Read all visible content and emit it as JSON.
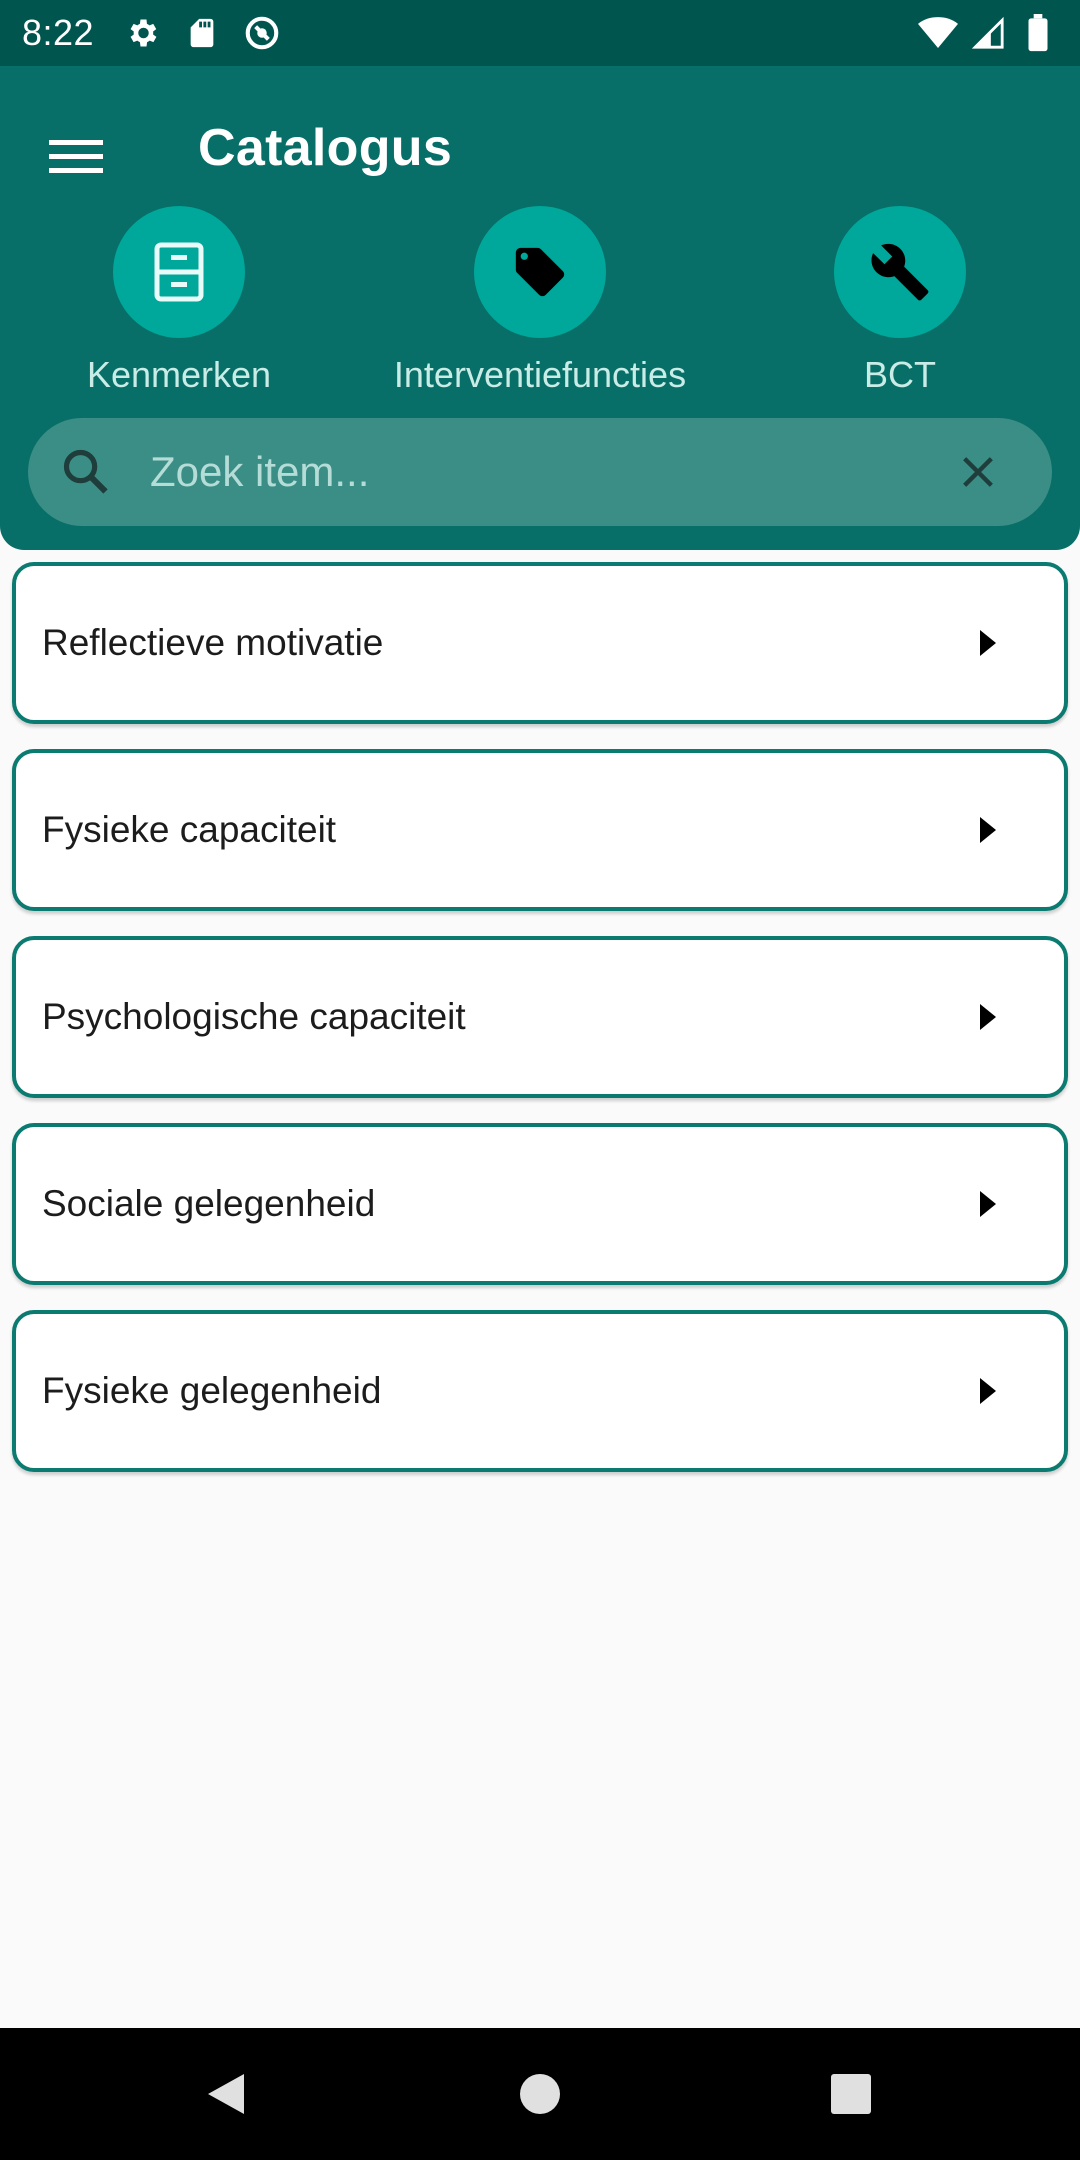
{
  "status_bar": {
    "time": "8:22",
    "icons_left": [
      "settings-icon",
      "sd-card-icon",
      "sync-icon"
    ],
    "icons_right": [
      "wifi-icon",
      "cell-signal-icon",
      "battery-icon"
    ]
  },
  "header": {
    "title": "Catalogus",
    "menu_icon": "hamburger-menu-icon"
  },
  "categories": [
    {
      "label": "Kenmerken",
      "icon": "cabinet-icon"
    },
    {
      "label": "Interventiefuncties",
      "icon": "tag-icon"
    },
    {
      "label": "BCT",
      "icon": "wrench-icon"
    }
  ],
  "search": {
    "value": "",
    "placeholder": "Zoek item...",
    "icon": "search-icon",
    "clear_icon": "close-icon"
  },
  "items": [
    {
      "label": "Reflectieve motivatie"
    },
    {
      "label": "Fysieke capaciteit"
    },
    {
      "label": "Psychologische capaciteit"
    },
    {
      "label": "Sociale gelegenheid"
    },
    {
      "label": "Fysieke gelegenheid"
    }
  ],
  "nav_bar": [
    "back-icon",
    "home-icon",
    "recent-apps-icon"
  ],
  "colors": {
    "status_bar": "#00564f",
    "header": "#076f67",
    "category_circle": "#00a79b",
    "search_bg": "#3a8e86",
    "card_border": "#0b7a70",
    "background": "#fafafa"
  }
}
